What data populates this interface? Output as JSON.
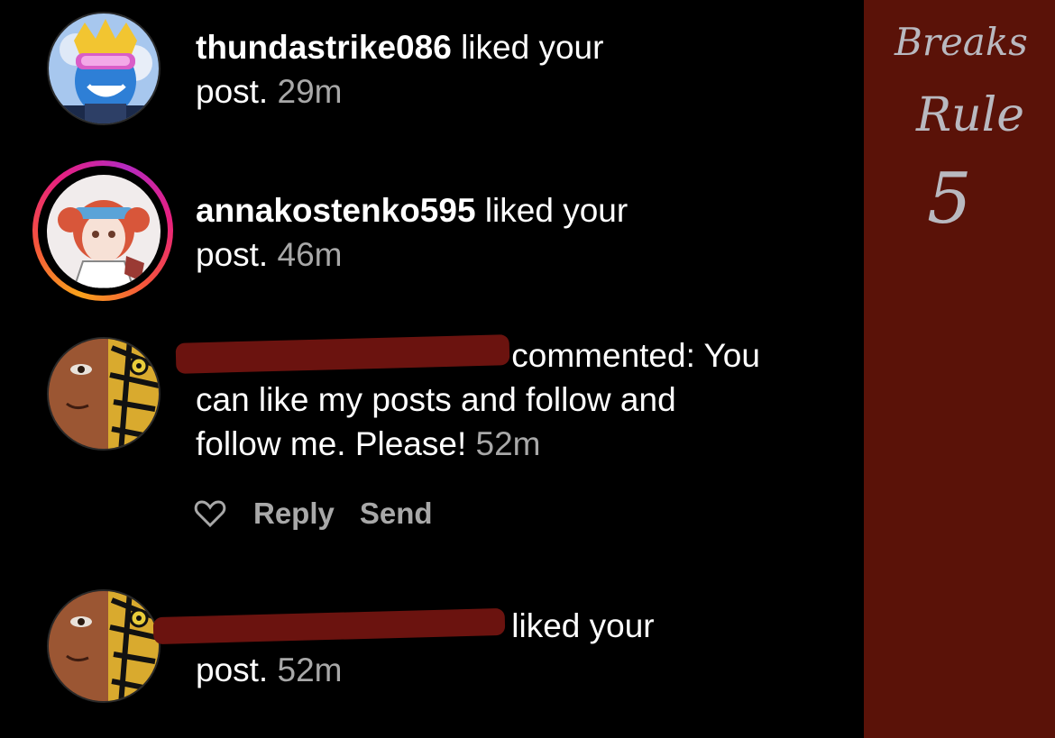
{
  "notifications": [
    {
      "username": "thundastrike086",
      "action": "liked your",
      "action_line2": "post.",
      "time": "29m",
      "avatar_icon": "avatar-crowned-character-icon"
    },
    {
      "username": "annakostenko595",
      "action": "liked your",
      "action_line2": "post.",
      "time": "46m",
      "avatar_icon": "avatar-anime-girl-icon",
      "story_ring": true
    },
    {
      "username": "",
      "action": "commented: You",
      "line2": "can like my posts and follow and",
      "line3": "follow me. Please!",
      "time": "52m",
      "avatar_icon": "avatar-face-tiger-icon",
      "actions": {
        "reply_label": "Reply",
        "send_label": "Send",
        "like_icon": "heart-outline-icon"
      }
    },
    {
      "username": "",
      "action": "liked your",
      "action_line2": "post.",
      "time": "52m",
      "avatar_icon": "avatar-face-tiger-icon"
    }
  ],
  "annotation": {
    "line1": "Breaks",
    "line2": "Rule",
    "line3": "5",
    "color": "#5a1208"
  },
  "colors": {
    "background": "#000000",
    "text": "#ffffff",
    "muted": "#a8a8a8",
    "redaction": "#6b130f"
  }
}
